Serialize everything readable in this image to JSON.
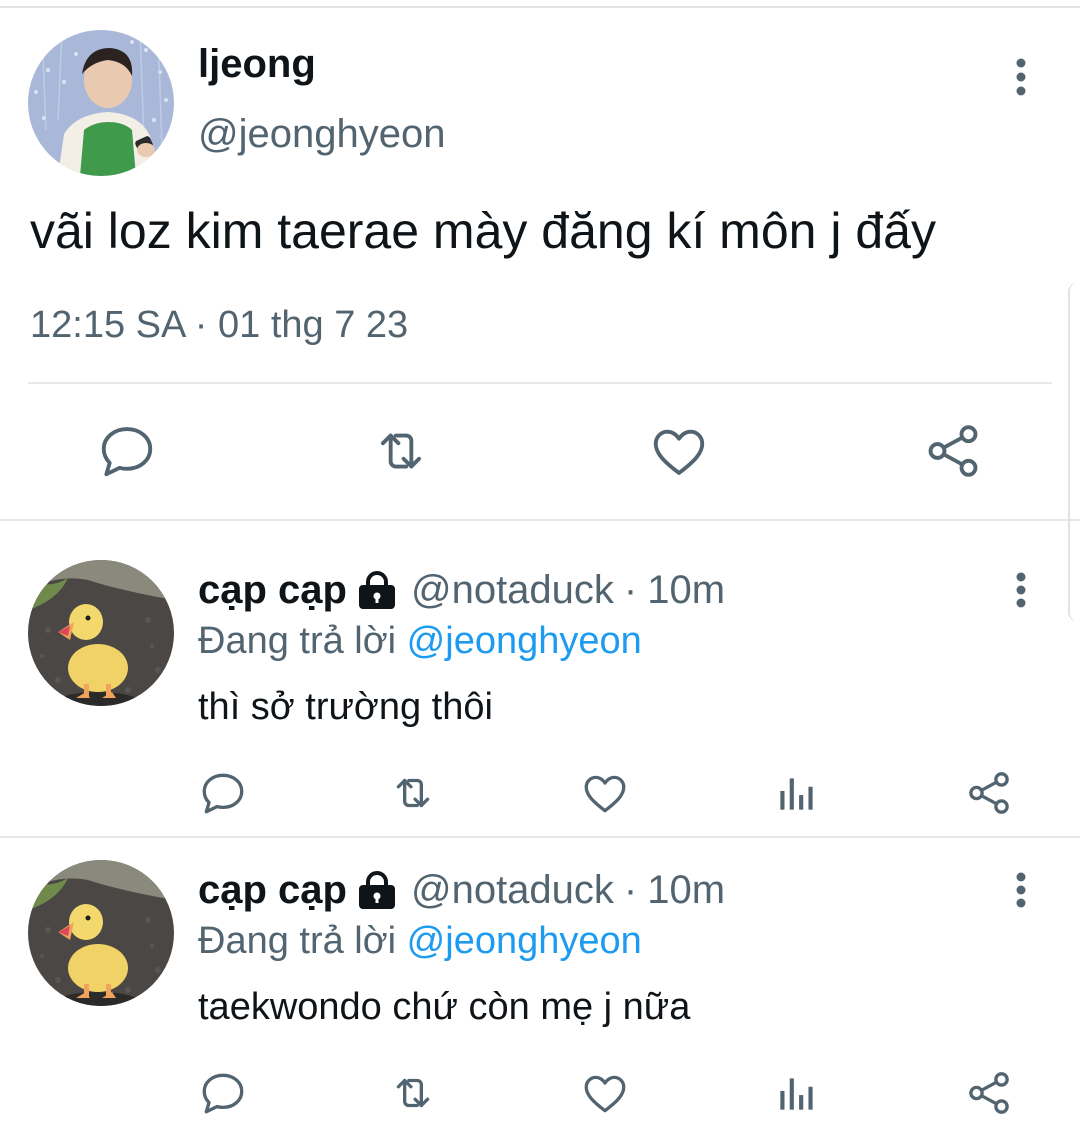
{
  "main_tweet": {
    "display_name": "ljeong",
    "handle": "@jeonghyeon",
    "text": "vãi loz kim taerae mày đăng kí môn j đấy",
    "timestamp": "12:15 SA · 01 thg 7 23",
    "actions": [
      "reply-icon",
      "retweet-icon",
      "like-icon",
      "share-icon"
    ]
  },
  "replies": [
    {
      "display_name": "cạp cạp",
      "handle": "@notaduck",
      "separator": "·",
      "time": "10m",
      "replying_prefix": "Đang trả lời",
      "replying_to": "@jeonghyeon",
      "text": "thì sở trường thôi"
    },
    {
      "display_name": "cạp cạp",
      "handle": "@notaduck",
      "separator": "·",
      "time": "10m",
      "replying_prefix": "Đang trả lời",
      "replying_to": "@jeonghyeon",
      "text": "taekwondo chứ còn mẹ j nữa"
    }
  ],
  "colors": {
    "text": "#0f1419",
    "secondary": "#536471",
    "link": "#1d9bf0",
    "divider": "#e6e9ec"
  }
}
